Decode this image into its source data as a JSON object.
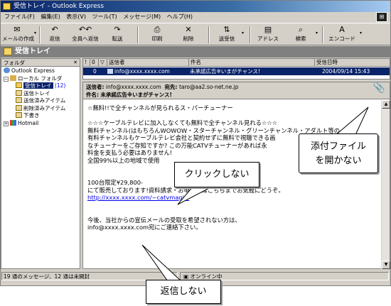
{
  "window": {
    "title": "受信トレイ - Outlook Express"
  },
  "menu": [
    "ファイル(F)",
    "編集(E)",
    "表示(V)",
    "ツール(T)",
    "メッセージ(M)",
    "ヘルプ(H)"
  ],
  "toolbar": {
    "compose": "メールの作成",
    "reply": "返信",
    "reply_all": "全員へ返信",
    "forward": "転送",
    "print": "印刷",
    "delete": "削除",
    "send_receive": "送受信",
    "addresses": "アドレス",
    "find": "検索",
    "encoding": "エンコード"
  },
  "folder_bar": {
    "title": "受信トレイ"
  },
  "folders": {
    "header": "フォルダ",
    "items": [
      {
        "label": "Outlook Express"
      },
      {
        "label": "ローカル フォルダ"
      },
      {
        "label": "受信トレイ",
        "count": "(12)"
      },
      {
        "label": "送信トレイ"
      },
      {
        "label": "送信済みアイテム"
      },
      {
        "label": "削除済みアイテム"
      },
      {
        "label": "下書き"
      },
      {
        "label": "Hotmail"
      }
    ]
  },
  "message_list": {
    "columns": [
      "!",
      "0",
      "▽",
      "送信者",
      "件名",
      "受信日時"
    ],
    "rows": [
      {
        "sender": "info@xxxx.xxxx.com",
        "subject": "未承諾広告※いまがチャンス!",
        "date": "2004/09/14 15:43"
      }
    ]
  },
  "preview": {
    "from_label": "送信者:",
    "from": "info@xxxx.xxxx.com",
    "to_label": "宛先:",
    "to": "taro@aa2.so-net.ne.jp",
    "subject_label": "件名:",
    "subject": "未承諾広告※いまがチャンス!",
    "body": [
      "☆無料!!で全チャンネルが見られるス・パーチューナー",
      "",
      "☆☆☆ケーブルテレビに加入しなくても無料で全チャンネル見れる☆☆☆",
      "無料チャンネル(はもちろんWOWOW・スターチャンネル・グリーンチャンネル・アダルト等の",
      "有料チャンネルもケーブルテレビ会社と契約せずに無料で視聴できる画",
      "なチューナーをご存知ですか? この万能CATVチューナーがあれば永",
      "料金を支払う必要はありません!",
      "全国99%以上の地域で使用",
      "",
      "",
      "100台限定¥29,800-",
      "にて販売しております!資料請求・お申込みはこちらまでお気軽にどうぞ。",
      "http://xxxx.xxxx.com/~catvmagic/",
      "",
      "",
      "今後、当社からの宣伝メールの受取を希望されない方は、",
      "info@xxxx.xxxx.com宛にご連絡下さい。"
    ]
  },
  "status": {
    "count_text": "19 通のメッセージ、12 通は未開封",
    "online": "オンライン中"
  },
  "callouts": {
    "attachment": "添付ファイル\nを開かない",
    "no_click": "クリックしない",
    "no_reply": "返信しない"
  }
}
